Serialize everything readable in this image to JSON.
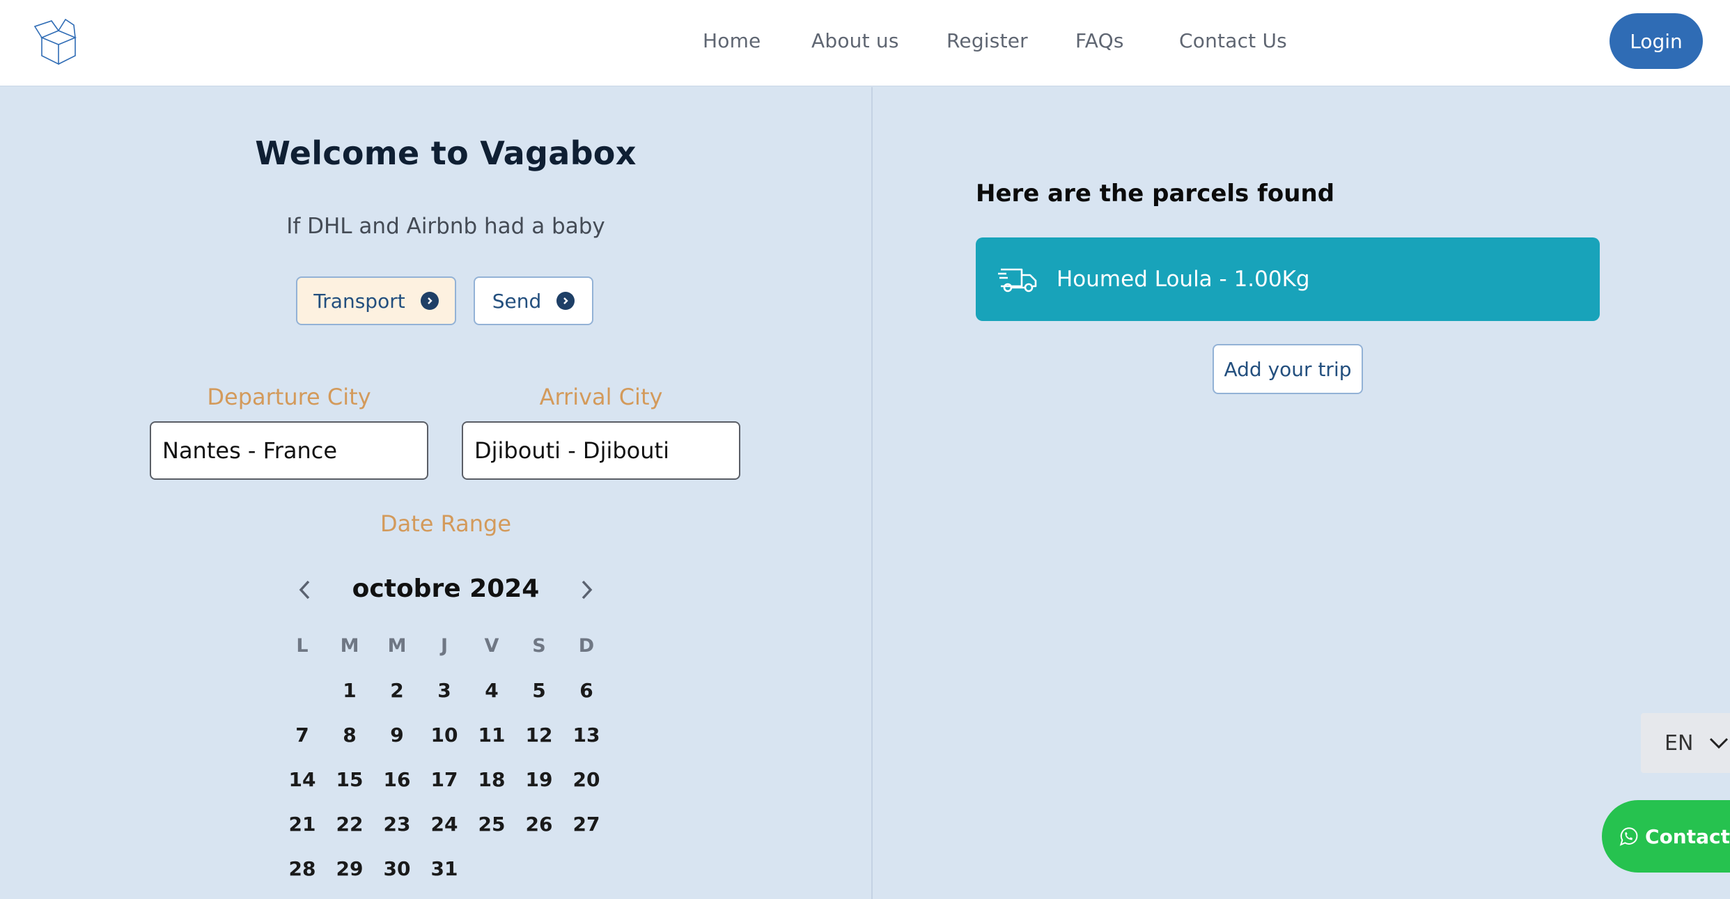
{
  "nav": {
    "items": [
      {
        "label": "Home"
      },
      {
        "label": "About us"
      },
      {
        "label": "Register"
      },
      {
        "label": "FAQs"
      },
      {
        "label": "Contact Us"
      }
    ],
    "login_label": "Login"
  },
  "hero": {
    "title": "Welcome to Vagabox",
    "tagline": "If DHL and Airbnb had a baby",
    "transport_label": "Transport",
    "send_label": "Send"
  },
  "search": {
    "departure_label": "Departure City",
    "departure_value": "Nantes - France",
    "arrival_label": "Arrival City",
    "arrival_value": "Djibouti - Djibouti",
    "date_label": "Date Range"
  },
  "calendar": {
    "month_label": "octobre 2024",
    "weekdays": [
      "L",
      "M",
      "M",
      "J",
      "V",
      "S",
      "D"
    ],
    "weeks": [
      [
        "",
        "1",
        "2",
        "3",
        "4",
        "5",
        "6"
      ],
      [
        "7",
        "8",
        "9",
        "10",
        "11",
        "12",
        "13"
      ],
      [
        "14",
        "15",
        "16",
        "17",
        "18",
        "19",
        "20"
      ],
      [
        "21",
        "22",
        "23",
        "24",
        "25",
        "26",
        "27"
      ],
      [
        "28",
        "29",
        "30",
        "31",
        "",
        "",
        ""
      ]
    ]
  },
  "results": {
    "title": "Here are the parcels found",
    "parcels": [
      {
        "label": "Houmed Loula - 1.00Kg"
      }
    ],
    "add_trip_label": "Add your trip"
  },
  "language": {
    "selected": "EN"
  },
  "whatsapp": {
    "label": "Contact"
  },
  "colors": {
    "background": "#d8e4f1",
    "primary": "#2f6cb5",
    "accent_label": "#d39a5b",
    "parcel_card": "#18a3ba",
    "whatsapp": "#26c24f"
  }
}
